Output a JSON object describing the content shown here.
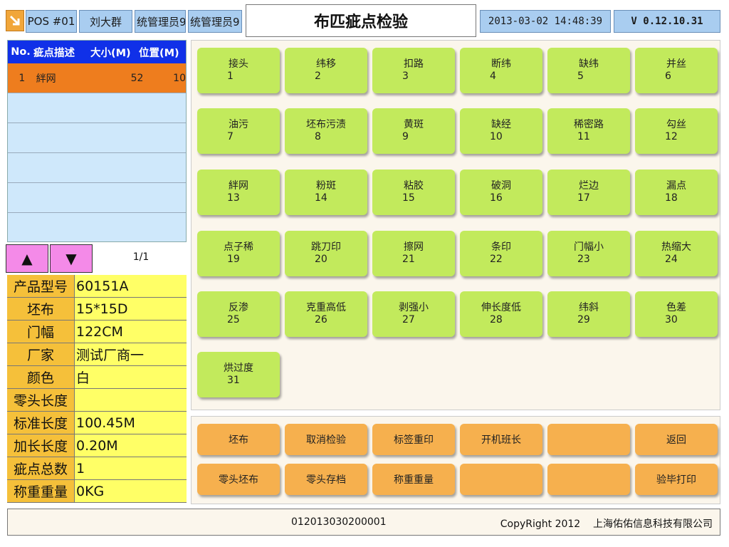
{
  "topbar": {
    "pos": "POS #01",
    "user": "刘大群",
    "role1": "统管理员9",
    "role2": "统管理员9",
    "title": "布匹疵点检验",
    "datetime": "2013-03-02 14:48:39",
    "version": "V 0.12.10.31"
  },
  "defect_list": {
    "headers": [
      "No.",
      "疵点描述",
      "大小(M)",
      "位置(M)"
    ],
    "rows": [
      {
        "no": "1",
        "desc": "絆网",
        "size": "52",
        "pos": "10"
      },
      {
        "no": "",
        "desc": "",
        "size": "",
        "pos": ""
      },
      {
        "no": "",
        "desc": "",
        "size": "",
        "pos": ""
      },
      {
        "no": "",
        "desc": "",
        "size": "",
        "pos": ""
      },
      {
        "no": "",
        "desc": "",
        "size": "",
        "pos": ""
      },
      {
        "no": "",
        "desc": "",
        "size": "",
        "pos": ""
      }
    ],
    "page": "1/1",
    "up_icon": "▲",
    "down_icon": "▼"
  },
  "info": [
    {
      "label": "产品型号",
      "value": "60151A"
    },
    {
      "label": "坯布",
      "value": "15*15D"
    },
    {
      "label": "门幅",
      "value": "122CM"
    },
    {
      "label": "厂家",
      "value": "测试厂商一"
    },
    {
      "label": "颜色",
      "value": "白"
    },
    {
      "label": "零头长度",
      "value": ""
    },
    {
      "label": "标准长度",
      "value": "100.45M"
    },
    {
      "label": "加长长度",
      "value": "0.20M"
    },
    {
      "label": "疵点总数",
      "value": "1"
    },
    {
      "label": "称重重量",
      "value": "0KG"
    }
  ],
  "defects": [
    {
      "name": "接头",
      "no": "1"
    },
    {
      "name": "纬移",
      "no": "2"
    },
    {
      "name": "扣路",
      "no": "3"
    },
    {
      "name": "断纬",
      "no": "4"
    },
    {
      "name": "缺纬",
      "no": "5"
    },
    {
      "name": "并丝",
      "no": "6"
    },
    {
      "name": "油污",
      "no": "7"
    },
    {
      "name": "坯布污渍",
      "no": "8"
    },
    {
      "name": "黄斑",
      "no": "9"
    },
    {
      "name": "缺经",
      "no": "10"
    },
    {
      "name": "稀密路",
      "no": "11"
    },
    {
      "name": "勾丝",
      "no": "12"
    },
    {
      "name": "絆网",
      "no": "13"
    },
    {
      "name": "粉斑",
      "no": "14"
    },
    {
      "name": "粘胶",
      "no": "15"
    },
    {
      "name": "破洞",
      "no": "16"
    },
    {
      "name": "烂边",
      "no": "17"
    },
    {
      "name": "漏点",
      "no": "18"
    },
    {
      "name": "点子稀",
      "no": "19"
    },
    {
      "name": "跳刀印",
      "no": "20"
    },
    {
      "name": "擦网",
      "no": "21"
    },
    {
      "name": "条印",
      "no": "22"
    },
    {
      "name": "门幅小",
      "no": "23"
    },
    {
      "name": "热缩大",
      "no": "24"
    },
    {
      "name": "反渗",
      "no": "25"
    },
    {
      "name": "克重高低",
      "no": "26"
    },
    {
      "name": "剥强小",
      "no": "27"
    },
    {
      "name": "伸长度低",
      "no": "28"
    },
    {
      "name": "纬斜",
      "no": "29"
    },
    {
      "name": "色差",
      "no": "30"
    },
    {
      "name": "烘过度",
      "no": "31"
    }
  ],
  "actions": [
    "坯布",
    "取消检验",
    "标签重印",
    "开机班长",
    "",
    "返回",
    "零头坯布",
    "零头存档",
    "称重重量",
    "",
    "",
    "验毕打印"
  ],
  "status": {
    "serial": "012013030200001",
    "copyright": "CopyRight 2012    上海佑佑信息科技有限公司"
  },
  "colors": {
    "header_blue": "#1030e8",
    "selected_row": "#ee7d1e",
    "defect_button": "#c2ea5c",
    "action_button": "#f6b04e",
    "info_label": "#f5c03a",
    "info_value": "#ffff66",
    "topbar_box": "#a9cdf0",
    "pager_button": "#f48ae8"
  }
}
